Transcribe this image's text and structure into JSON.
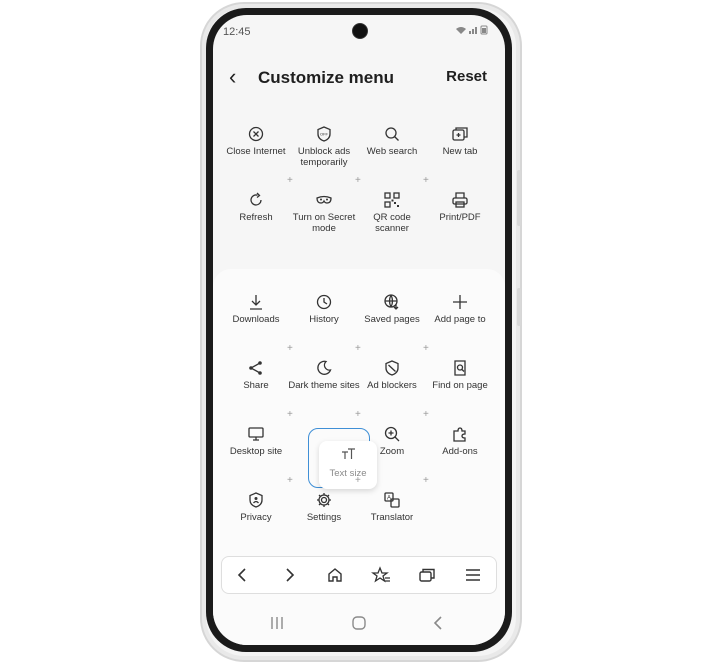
{
  "status": {
    "time": "12:45",
    "indicators": "wifi-icon signal-icon battery-icon"
  },
  "header": {
    "title": "Customize menu",
    "back_icon": "back-arrow-icon",
    "reset_label": "Reset"
  },
  "toolbar_items": [
    {
      "name": "close-internet",
      "label": "Close Internet",
      "icon": "close-circle-icon"
    },
    {
      "name": "unblock-ads",
      "label": "Unblock ads temporarily",
      "icon": "shield-off-icon"
    },
    {
      "name": "web-search",
      "label": "Web search",
      "icon": "search-icon"
    },
    {
      "name": "new-tab",
      "label": "New tab",
      "icon": "new-tab-icon"
    },
    {
      "name": "refresh",
      "label": "Refresh",
      "icon": "refresh-icon"
    },
    {
      "name": "secret-mode",
      "label": "Turn on Secret mode",
      "icon": "mask-icon"
    },
    {
      "name": "qr-scanner",
      "label": "QR code scanner",
      "icon": "qr-code-icon"
    },
    {
      "name": "print-pdf",
      "label": "Print/PDF",
      "icon": "printer-icon"
    }
  ],
  "menu_items": [
    {
      "name": "downloads",
      "label": "Downloads",
      "icon": "download-icon"
    },
    {
      "name": "history",
      "label": "History",
      "icon": "clock-icon"
    },
    {
      "name": "saved-pages",
      "label": "Saved pages",
      "icon": "globe-download-icon"
    },
    {
      "name": "add-page-to",
      "label": "Add page to",
      "icon": "plus-icon"
    },
    {
      "name": "share",
      "label": "Share",
      "icon": "share-icon"
    },
    {
      "name": "dark-theme-sites",
      "label": "Dark theme sites",
      "icon": "moon-icon"
    },
    {
      "name": "ad-blockers",
      "label": "Ad blockers",
      "icon": "shield-block-icon"
    },
    {
      "name": "find-on-page",
      "label": "Find on page",
      "icon": "find-icon"
    },
    {
      "name": "desktop-site",
      "label": "Desktop site",
      "icon": "desktop-icon"
    },
    {
      "name": "text-size-slot",
      "label": "",
      "icon": ""
    },
    {
      "name": "zoom",
      "label": "Zoom",
      "icon": "zoom-in-icon"
    },
    {
      "name": "add-ons",
      "label": "Add-ons",
      "icon": "puzzle-icon"
    },
    {
      "name": "privacy",
      "label": "Privacy",
      "icon": "privacy-shield-icon"
    },
    {
      "name": "settings",
      "label": "Settings",
      "icon": "gear-icon"
    },
    {
      "name": "translator",
      "label": "Translator",
      "icon": "translate-icon"
    }
  ],
  "dragging_item": {
    "label": "Text size",
    "icon": "text-size-icon"
  },
  "bottom_toolbar": [
    {
      "name": "back",
      "icon": "chevron-left-icon"
    },
    {
      "name": "forward",
      "icon": "chevron-right-icon"
    },
    {
      "name": "home",
      "icon": "home-icon"
    },
    {
      "name": "bookmarks",
      "icon": "star-list-icon"
    },
    {
      "name": "tabs",
      "icon": "tabs-icon"
    },
    {
      "name": "menu",
      "icon": "hamburger-icon"
    }
  ],
  "navbar": [
    {
      "name": "recents",
      "icon": "recents-icon"
    },
    {
      "name": "home",
      "icon": "home-circle-icon"
    },
    {
      "name": "back",
      "icon": "back-chevron-icon"
    }
  ],
  "colors": {
    "accent": "#3f8fd6",
    "screen_bg": "#f6f6f6",
    "panel_bg": "#fbfbfb"
  }
}
